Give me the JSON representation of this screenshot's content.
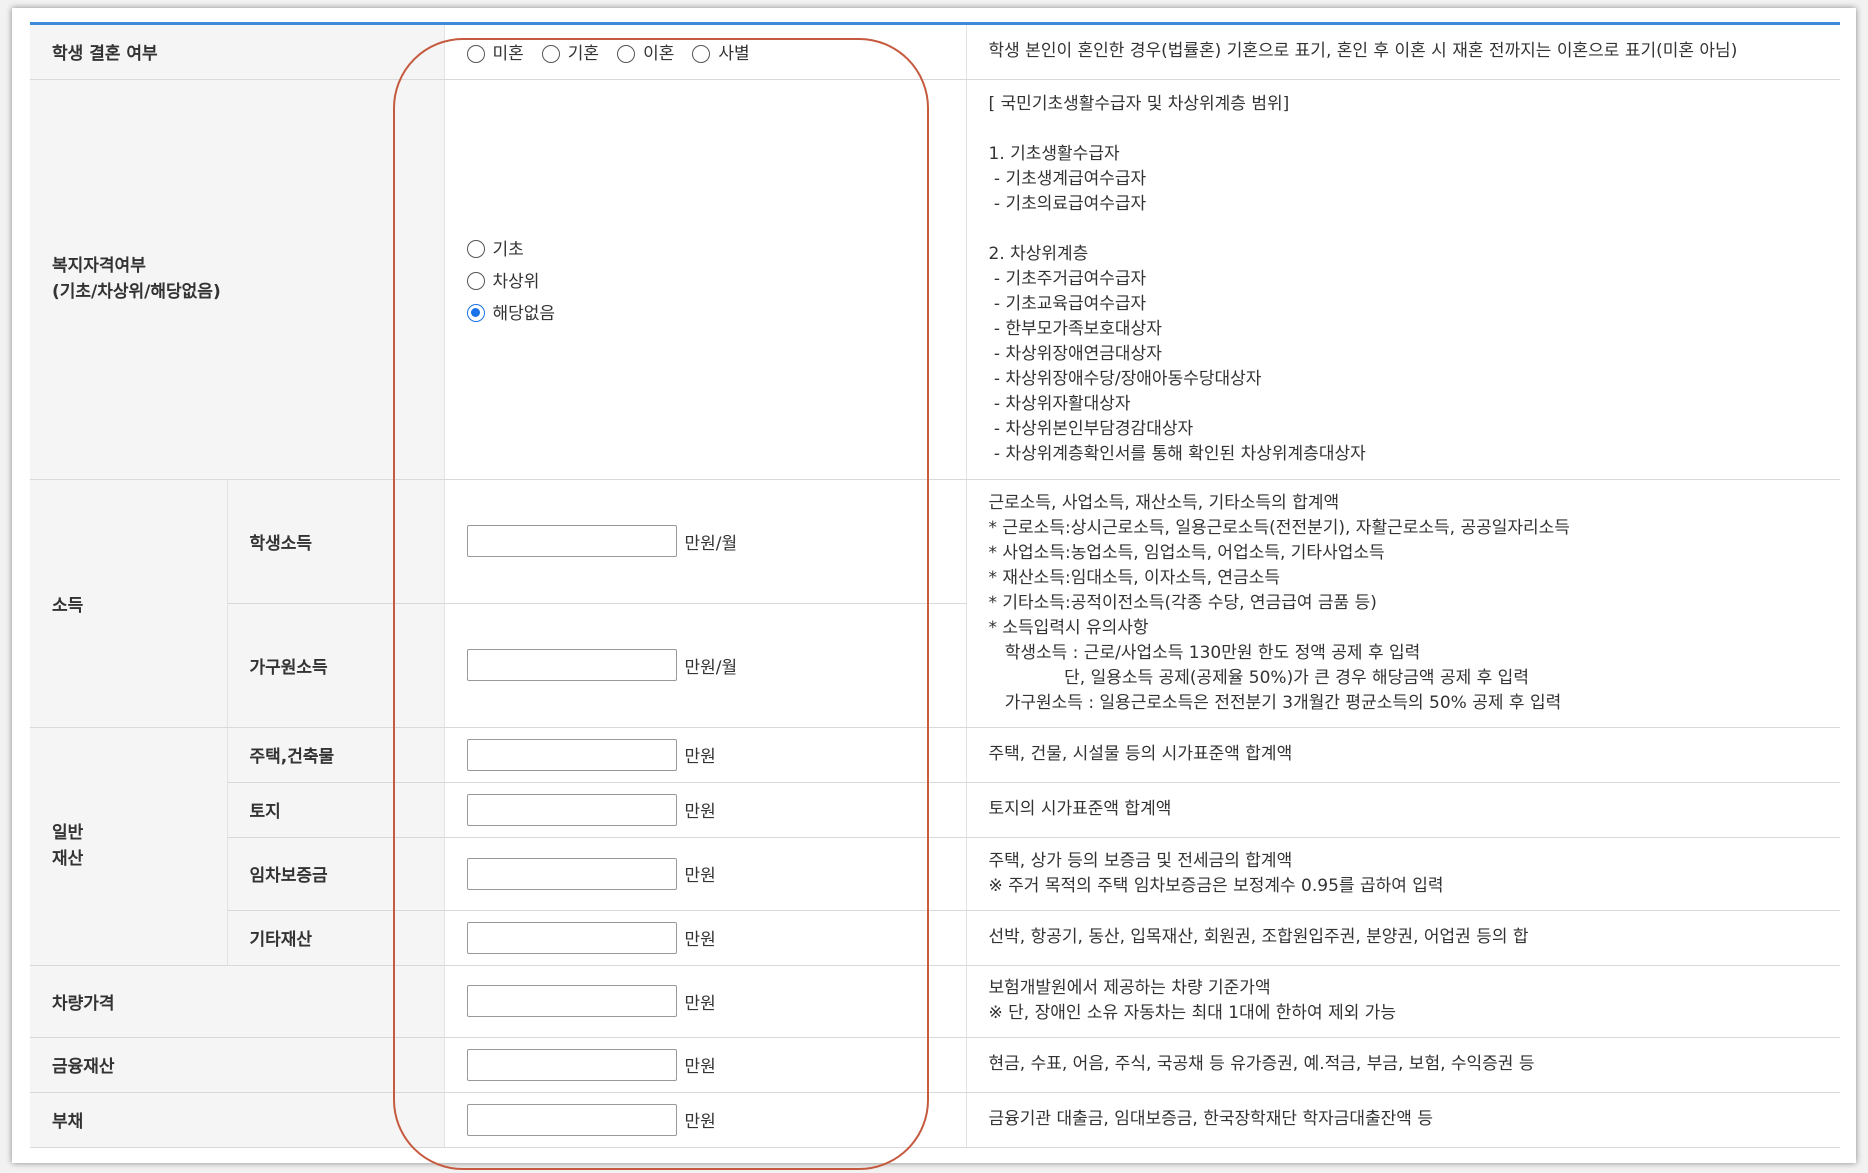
{
  "rows": {
    "marriage": {
      "label": "학생 결혼 여부",
      "options": [
        "미혼",
        "기혼",
        "이혼",
        "사별"
      ],
      "desc": "학생 본인이 혼인한 경우(법률혼) 기혼으로 표기, 혼인 후 이혼 시 재혼 전까지는 이혼으로 표기(미혼 아님)"
    },
    "welfare": {
      "label_line1": "복지자격여부",
      "label_line2": "(기초/차상위/해당없음)",
      "options": [
        "기초",
        "차상위",
        "해당없음"
      ],
      "selected": "해당없음",
      "desc": "[ 국민기초생활수급자 및 차상위계층 범위]\n\n1. 기초생활수급자\n - 기초생계급여수급자\n - 기초의료급여수급자\n\n2. 차상위계층\n - 기초주거급여수급자\n - 기초교육급여수급자\n - 한부모가족보호대상자\n - 차상위장애연금대상자\n - 차상위장애수당/장애아동수당대상자\n - 차상위자활대상자\n - 차상위본인부담경감대상자\n - 차상위계층확인서를 통해 확인된 차상위계층대상자"
    },
    "income": {
      "label": "소득",
      "student": {
        "label": "학생소득",
        "unit": "만원/월",
        "value": ""
      },
      "household": {
        "label": "가구원소득",
        "unit": "만원/월",
        "value": ""
      },
      "desc": "근로소득, 사업소득, 재산소득, 기타소득의 합계액\n* 근로소득:상시근로소득, 일용근로소득(전전분기), 자활근로소득, 공공일자리소득\n* 사업소득:농업소득, 임업소득, 어업소득, 기타사업소득\n* 재산소득:임대소득, 이자소득, 연금소득\n* 기타소득:공적이전소득(각종 수당, 연금급여 금품 등)\n* 소득입력시 유의사항\n   학생소득 : 근로/사업소득 130만원 한도 정액 공제 후 입력\n              단, 일용소득 공제(공제율 50%)가 큰 경우 해당금액 공제 후 입력\n   가구원소득 : 일용근로소득은 전전분기 3개월간 평균소득의 50% 공제 후 입력"
    },
    "property": {
      "label_line1": "일반",
      "label_line2": "재산",
      "housing": {
        "label": "주택,건축물",
        "unit": "만원",
        "value": "",
        "desc": "주택, 건물, 시설물 등의 시가표준액 합계액"
      },
      "land": {
        "label": "토지",
        "unit": "만원",
        "value": "",
        "desc": "토지의 시가표준액 합계액"
      },
      "deposit": {
        "label": "임차보증금",
        "unit": "만원",
        "value": "",
        "desc_line1": "주택, 상가 등의 보증금 및 전세금의 합계액",
        "desc_line2": "※ 주거 목적의 주택 임차보증금은 보정계수 0.95를 곱하여 입력"
      },
      "other": {
        "label": "기타재산",
        "unit": "만원",
        "value": "",
        "desc": "선박, 항공기, 동산, 입목재산, 회원권, 조합원입주권, 분양권, 어업권 등의 합"
      }
    },
    "vehicle": {
      "label": "차량가격",
      "unit": "만원",
      "value": "",
      "desc_line1": "보험개발원에서 제공하는 차량 기준가액",
      "desc_line2": "※ 단, 장애인 소유 자동차는 최대 1대에 한하여 제외 가능"
    },
    "financial": {
      "label": "금융재산",
      "unit": "만원",
      "value": "",
      "desc": "현금, 수표, 어음, 주식, 국공채 등 유가증권, 예.적금, 부금, 보험, 수익증권 등"
    },
    "debt": {
      "label": "부채",
      "unit": "만원",
      "value": "",
      "desc": "금융기관 대출금, 임대보증금, 한국장학재단 학자금대출잔액 등"
    }
  },
  "colors": {
    "accent_line": "#3f8ad8",
    "highlight": "#c55a3f",
    "radio_selected": "#1a73e8"
  }
}
